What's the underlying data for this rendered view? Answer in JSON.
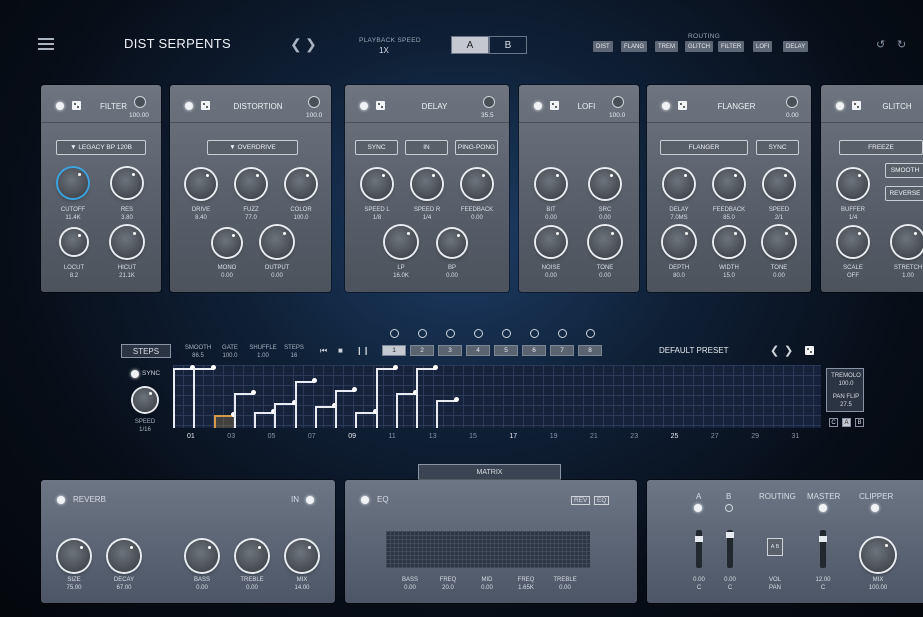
{
  "header": {
    "title": "DIST SERPENTS",
    "playback_label": "PLAYBACK SPEED",
    "playback_value": "1X",
    "ab_a": "A",
    "ab_b": "B",
    "routing_label": "ROUTING",
    "routing": [
      "DIST",
      "FLANG",
      "TREM",
      "GLITCH",
      "FILTER",
      "LOFI",
      "DELAY"
    ],
    "undo_icon": "undo-icon",
    "redo_icon": "redo-icon"
  },
  "filter": {
    "title": "FILTER",
    "mix": "100.00",
    "preset": "LEGACY BP 120B",
    "knobs": [
      {
        "label": "CUTOFF",
        "value": "11.4K"
      },
      {
        "label": "RES",
        "value": "3.80"
      },
      {
        "label": "LOCUT",
        "value": "8.2"
      },
      {
        "label": "HICUT",
        "value": "21.1K"
      }
    ]
  },
  "distortion": {
    "title": "DISTORTION",
    "mix": "100.0",
    "preset": "OVERDRIVE",
    "knobs": [
      {
        "label": "DRIVE",
        "value": "8.40"
      },
      {
        "label": "FUZZ",
        "value": "77.0"
      },
      {
        "label": "COLOR",
        "value": "100.0"
      },
      {
        "label": "MONO",
        "value": "0.00"
      },
      {
        "label": "OUTPUT",
        "value": "0.00"
      }
    ]
  },
  "delay": {
    "title": "DELAY",
    "mix": "35.5",
    "buttons": [
      "SYNC",
      "IN",
      "PING-PONG"
    ],
    "knobs": [
      {
        "label": "SPEED L",
        "value": "1/8"
      },
      {
        "label": "SPEED R",
        "value": "1/4"
      },
      {
        "label": "FEEDBACK",
        "value": "0.00"
      },
      {
        "label": "LP",
        "value": "16.0K"
      },
      {
        "label": "BP",
        "value": "0.00"
      }
    ]
  },
  "lofi": {
    "title": "LOFI",
    "mix": "100.0",
    "knobs": [
      {
        "label": "BIT",
        "value": "0.00"
      },
      {
        "label": "SRC",
        "value": "0.00"
      },
      {
        "label": "NOISE",
        "value": "0.00"
      },
      {
        "label": "TONE",
        "value": "0.00"
      }
    ]
  },
  "flanger": {
    "title": "FLANGER",
    "mix": "0.00",
    "buttons": [
      "FLANGER",
      "SYNC"
    ],
    "knobs": [
      {
        "label": "DELAY",
        "value": "7.0MS"
      },
      {
        "label": "FEEDBACK",
        "value": "85.0"
      },
      {
        "label": "SPEED",
        "value": "2/1"
      },
      {
        "label": "DEPTH",
        "value": "80.0"
      },
      {
        "label": "WIDTH",
        "value": "15.0"
      },
      {
        "label": "TONE",
        "value": "0.00"
      }
    ]
  },
  "glitch": {
    "title": "GLITCH",
    "buttons": [
      "FREEZE",
      "SMOOTH",
      "REVERSE"
    ],
    "knobs": [
      {
        "label": "BUFFER",
        "value": "1/4"
      },
      {
        "label": "SCALE",
        "value": "OFF"
      },
      {
        "label": "STRETCH",
        "value": "1.00"
      }
    ]
  },
  "seq": {
    "tab": "STEPS",
    "params": [
      {
        "label": "SMOOTH",
        "value": "86.5"
      },
      {
        "label": "GATE",
        "value": "100.0"
      },
      {
        "label": "SHUFFLE",
        "value": "1.00"
      },
      {
        "label": "STEPS",
        "value": "16"
      }
    ],
    "transport": [
      "skip-back-icon",
      "stop-icon",
      "pause-icon"
    ],
    "patterns": [
      "1",
      "2",
      "3",
      "4",
      "5",
      "6",
      "7",
      "8"
    ],
    "preset": "DEFAULT PRESET",
    "sync": "SYNC",
    "speed_label": "SPEED",
    "speed_value": "1/16",
    "tremolo_label": "TREMOLO",
    "tremolo_value": "100.0",
    "panflip_label": "PAN FLIP",
    "panflip_value": "27.5",
    "abc": [
      "C",
      "A",
      "B"
    ],
    "ticks": [
      "01",
      "03",
      "05",
      "07",
      "09",
      "11",
      "13",
      "15",
      "17",
      "19",
      "21",
      "23",
      "25",
      "27",
      "29",
      "31"
    ],
    "steps": [
      0.95,
      0.95,
      0.2,
      0.55,
      0.25,
      0.4,
      0.75,
      0.35,
      0.6,
      0.25,
      0.95,
      0.55,
      0.95,
      0.45
    ]
  },
  "matrix": {
    "label": "MATRIX"
  },
  "reverb": {
    "title": "REVERB",
    "in": "IN",
    "knobs": [
      {
        "label": "SIZE",
        "value": "75.00"
      },
      {
        "label": "DECAY",
        "value": "67.00"
      },
      {
        "label": "BASS",
        "value": "0.00"
      },
      {
        "label": "TREBLE",
        "value": "0.00"
      },
      {
        "label": "MIX",
        "value": "14.00"
      }
    ]
  },
  "eq": {
    "title": "EQ",
    "rev": "REV",
    "eq": "EQ",
    "bands": [
      {
        "label": "BASS",
        "value": "0.00"
      },
      {
        "label": "FREQ",
        "value": "20.0"
      },
      {
        "label": "MID",
        "value": "0.00"
      },
      {
        "label": "FREQ",
        "value": "1.65K"
      },
      {
        "label": "TREBLE",
        "value": "0.00"
      }
    ]
  },
  "master": {
    "a": "A",
    "b": "B",
    "routing": "ROUTING",
    "master": "MASTER",
    "clipper": "CLIPPER",
    "faders": [
      {
        "label": "0.00",
        "sub": "C"
      },
      {
        "label": "0.00",
        "sub": "C"
      },
      {
        "label": "VOL",
        "sub": "PAN"
      },
      {
        "label": "12.00",
        "sub": "C"
      }
    ],
    "mix_label": "MIX",
    "mix_value": "100.00",
    "ab_tag": "A B"
  }
}
